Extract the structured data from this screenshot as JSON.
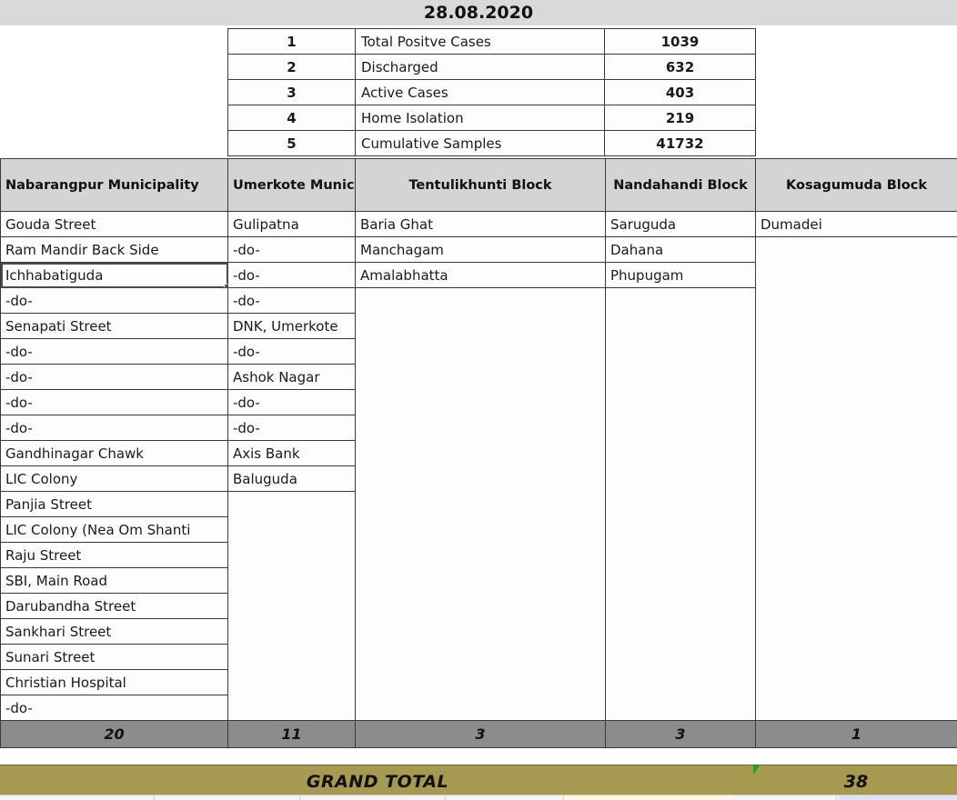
{
  "report": {
    "title": "28.08.2020",
    "title_bg": "#d9d9d9"
  },
  "summary": {
    "rows": [
      {
        "no": "1",
        "label": "Total Positve Cases",
        "value": "1039"
      },
      {
        "no": "2",
        "label": "Discharged",
        "value": "632"
      },
      {
        "no": "3",
        "label": "Active Cases",
        "value": "403"
      },
      {
        "no": "4",
        "label": "Home Isolation",
        "value": "219"
      },
      {
        "no": "5",
        "label": "Cumulative Samples",
        "value": "41732"
      }
    ]
  },
  "grid": {
    "headers": [
      "Nabarangpur Municipality",
      "Umerkote Municipality",
      "Tentulikhunti  Block",
      "Nandahandi Block",
      "Kosagumuda  Block"
    ],
    "columns": {
      "nabarangpur": [
        "Gouda Street",
        "Ram Mandir Back Side",
        "Ichhabatiguda",
        "-do-",
        "Senapati Street",
        "-do-",
        "-do-",
        "-do-",
        "-do-",
        "Gandhinagar Chawk",
        "LIC Colony",
        "Panjia Street",
        "LIC Colony (Nea Om Shanti",
        "Raju Street",
        "SBI, Main Road",
        "Darubandha Street",
        "Sankhari Street",
        "Sunari Street",
        "Christian Hospital",
        "-do-"
      ],
      "umerkote": [
        "Gulipatna",
        "-do-",
        "-do-",
        "-do-",
        "DNK, Umerkote",
        "-do-",
        "Ashok Nagar",
        "-do-",
        "-do-",
        "Axis Bank",
        "Baluguda"
      ],
      "tentulikhunti": [
        "Baria Ghat",
        "Manchagam",
        "Amalabhatta"
      ],
      "nandahandi": [
        "Saruguda",
        "Dahana",
        "Phupugam"
      ],
      "kosagumuda": [
        "Dumadei"
      ]
    },
    "selected_cell": "Ichhabatiguda",
    "totals": [
      "20",
      "11",
      "3",
      "3",
      "1"
    ],
    "totals_bg": "#8c8c8c"
  },
  "grand_total": {
    "label": "GRAND TOTAL",
    "value": "38",
    "band_color": "#a59a4f",
    "marker_color": "#1aa81a"
  }
}
